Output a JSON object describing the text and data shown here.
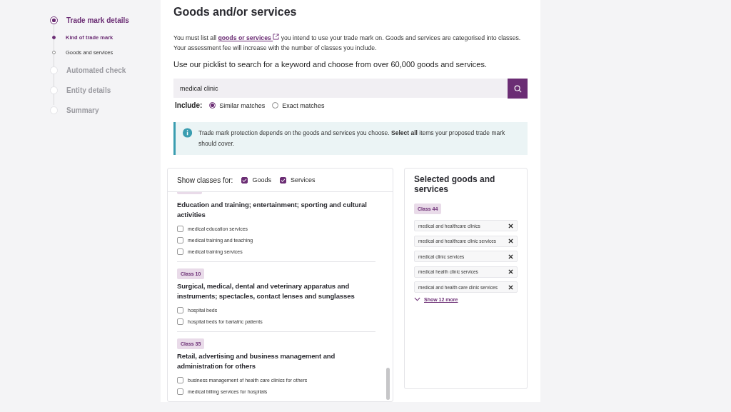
{
  "steps": [
    {
      "label": "Trade mark details",
      "current": true,
      "children": [
        {
          "label": "Kind of trade mark",
          "current": true
        },
        {
          "label": "Goods and services",
          "current": false
        }
      ]
    },
    {
      "label": "Automated check",
      "current": false
    },
    {
      "label": "Entity details",
      "current": false
    },
    {
      "label": "Summary",
      "current": false
    }
  ],
  "heading": "Goods and/or services",
  "intro": {
    "before": "You must list all",
    "link": "goods or services",
    "after": "you intend to use your trade mark on. Goods and services are categorised into classes. Your assessment fee will increase with the number of classes you include."
  },
  "lead": "Use our picklist to search for a keyword and choose from over 60,000 goods and services.",
  "search": {
    "value": "medical clinic"
  },
  "include": {
    "label": "Include:",
    "options": [
      {
        "label": "Similar matches",
        "selected": true
      },
      {
        "label": "Exact matches",
        "selected": false
      }
    ]
  },
  "notice": "Trade mark protection depends on the goods and services you choose. **Select all** items your proposed trade mark should cover.",
  "filter": {
    "label": "Show classes for:",
    "options": [
      {
        "label": "Goods",
        "checked": true
      },
      {
        "label": "Services",
        "checked": true
      }
    ]
  },
  "classes": [
    {
      "title": "Education and training; entertainment; sporting and cultural activities",
      "items": [
        {
          "label": "medical education services",
          "checked": false
        },
        {
          "label": "medical training and teaching",
          "checked": false
        },
        {
          "label": "medical training services",
          "checked": false
        }
      ]
    },
    {
      "badge": "Class 10",
      "title": "Surgical, medical, dental and veterinary apparatus and instruments; spectacles, contact lenses and sunglasses",
      "items": [
        {
          "label": "hospital beds",
          "checked": false
        },
        {
          "label": "hospital beds for bariatric patients",
          "checked": false
        }
      ]
    },
    {
      "badge": "Class 35",
      "title": "Retail, advertising and business management and administration for others",
      "items": [
        {
          "label": "business management of health care clinics for others",
          "checked": false
        },
        {
          "label": "medical billing services for hospitals",
          "checked": false
        }
      ]
    }
  ],
  "selected": {
    "title": "Selected goods and services",
    "badge": "Class 44",
    "items": [
      "medical and healthcare clinics",
      "medical and healthcare clinic services",
      "medical clinic services",
      "medical health clinic services",
      "medical and health care clinic services"
    ],
    "more": "Show 12 more"
  }
}
